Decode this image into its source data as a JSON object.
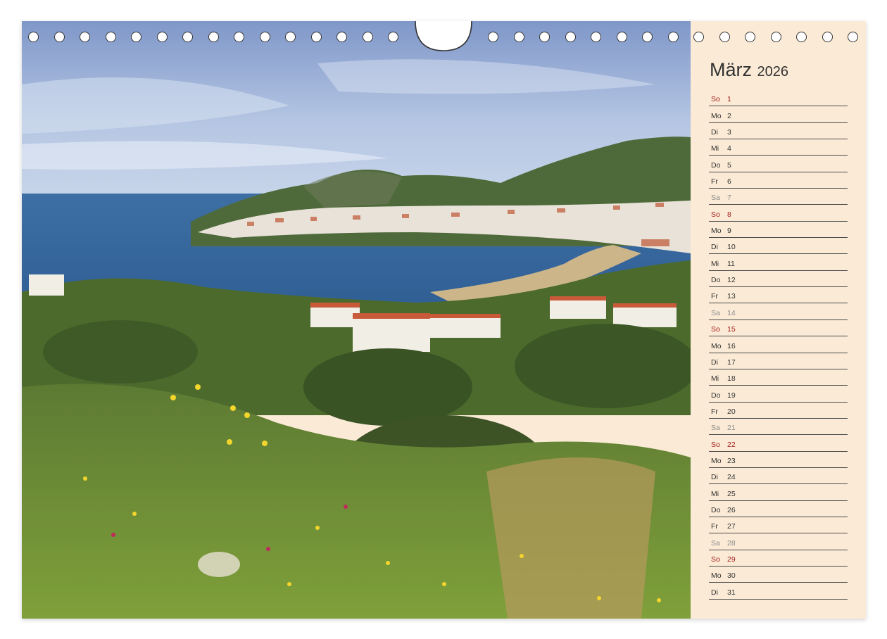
{
  "calendar": {
    "month": "März",
    "year": "2026",
    "days": [
      {
        "wd": "So",
        "n": "1",
        "type": "sun"
      },
      {
        "wd": "Mo",
        "n": "2",
        "type": "work"
      },
      {
        "wd": "Di",
        "n": "3",
        "type": "work"
      },
      {
        "wd": "Mi",
        "n": "4",
        "type": "work"
      },
      {
        "wd": "Do",
        "n": "5",
        "type": "work"
      },
      {
        "wd": "Fr",
        "n": "6",
        "type": "work"
      },
      {
        "wd": "Sa",
        "n": "7",
        "type": "sat"
      },
      {
        "wd": "So",
        "n": "8",
        "type": "sun"
      },
      {
        "wd": "Mo",
        "n": "9",
        "type": "work"
      },
      {
        "wd": "Di",
        "n": "10",
        "type": "work"
      },
      {
        "wd": "Mi",
        "n": "11",
        "type": "work"
      },
      {
        "wd": "Do",
        "n": "12",
        "type": "work"
      },
      {
        "wd": "Fr",
        "n": "13",
        "type": "work"
      },
      {
        "wd": "Sa",
        "n": "14",
        "type": "sat"
      },
      {
        "wd": "So",
        "n": "15",
        "type": "sun"
      },
      {
        "wd": "Mo",
        "n": "16",
        "type": "work"
      },
      {
        "wd": "Di",
        "n": "17",
        "type": "work"
      },
      {
        "wd": "Mi",
        "n": "18",
        "type": "work"
      },
      {
        "wd": "Do",
        "n": "19",
        "type": "work"
      },
      {
        "wd": "Fr",
        "n": "20",
        "type": "work"
      },
      {
        "wd": "Sa",
        "n": "21",
        "type": "sat"
      },
      {
        "wd": "So",
        "n": "22",
        "type": "sun"
      },
      {
        "wd": "Mo",
        "n": "23",
        "type": "work"
      },
      {
        "wd": "Di",
        "n": "24",
        "type": "work"
      },
      {
        "wd": "Mi",
        "n": "25",
        "type": "work"
      },
      {
        "wd": "Do",
        "n": "26",
        "type": "work"
      },
      {
        "wd": "Fr",
        "n": "27",
        "type": "work"
      },
      {
        "wd": "Sa",
        "n": "28",
        "type": "sat"
      },
      {
        "wd": "So",
        "n": "29",
        "type": "sun"
      },
      {
        "wd": "Mo",
        "n": "30",
        "type": "work"
      },
      {
        "wd": "Di",
        "n": "31",
        "type": "work"
      }
    ]
  },
  "colors": {
    "sidebar_bg": "#fbebd6",
    "sunday": "#a11d1d",
    "saturday": "#8a8a8a",
    "text": "#333333"
  },
  "photo": {
    "subject": "coastal-bay-town-landscape"
  }
}
